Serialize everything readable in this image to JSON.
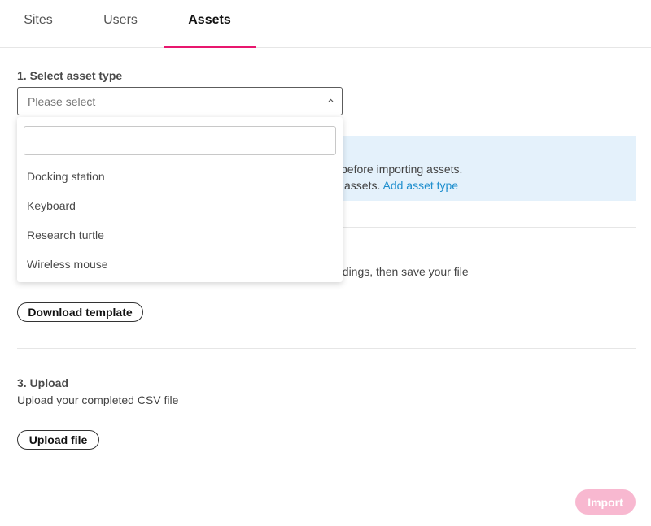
{
  "tabs": [
    {
      "label": "Sites",
      "active": false
    },
    {
      "label": "Users",
      "active": false
    },
    {
      "label": "Assets",
      "active": true
    }
  ],
  "step1": {
    "title": "1. Select asset type",
    "select_placeholder": "Please select",
    "dropdown": {
      "search_value": "",
      "options": [
        "Docking station",
        "Keyboard",
        "Research turtle",
        "Wireless mouse"
      ]
    }
  },
  "info": {
    "line1_visible": "before importing assets.",
    "line2_visible": "assets.",
    "link": "Add asset type"
  },
  "step2": {
    "desc_visible": "adings, then save your file",
    "download_button": "Download template"
  },
  "step3": {
    "title": "3. Upload",
    "desc": "Upload your completed CSV file",
    "upload_button": "Upload file"
  },
  "import_button": "Import",
  "colors": {
    "accent": "#e8176e",
    "info_bg": "#e4f1fb",
    "link": "#1f8fce",
    "import_disabled": "#f8b8d0"
  }
}
